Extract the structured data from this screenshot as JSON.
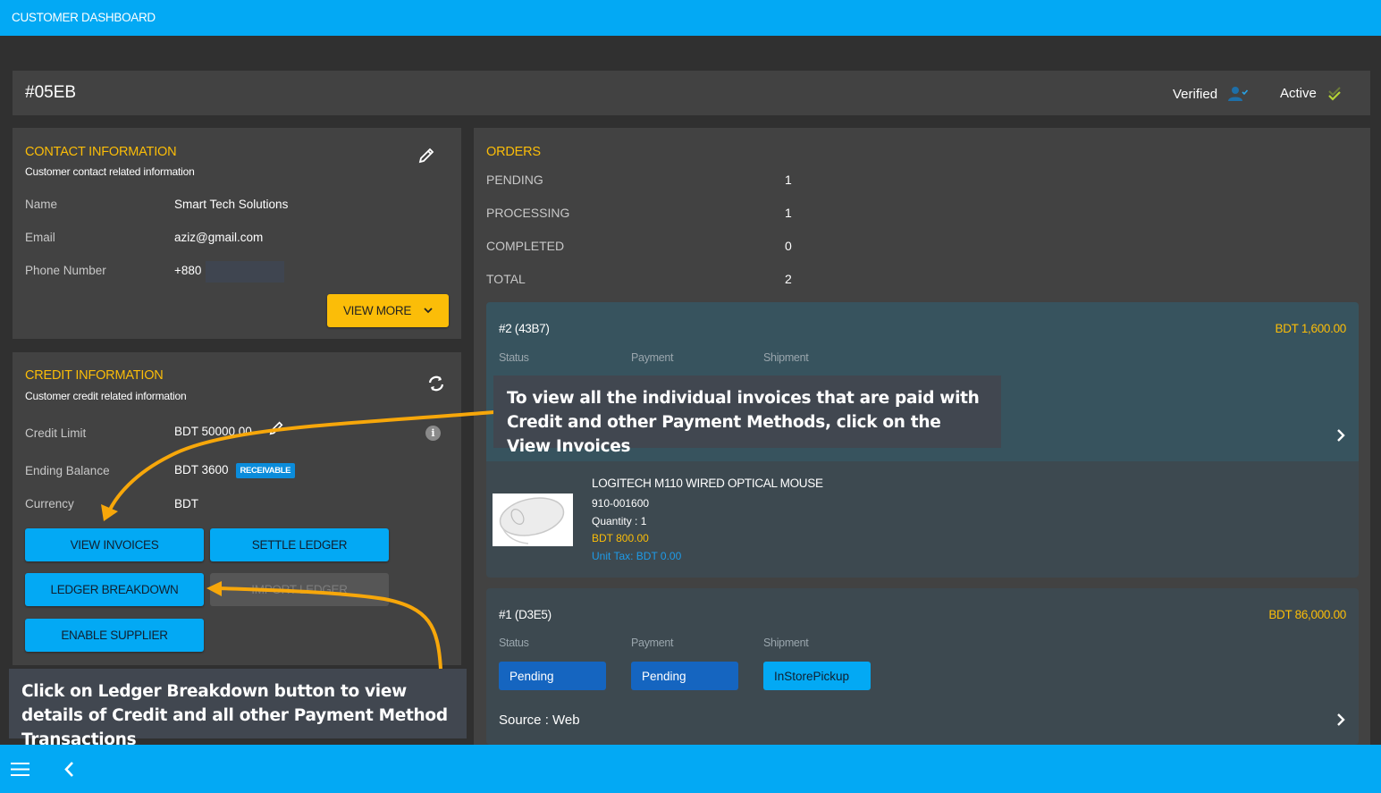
{
  "app": {
    "title": "CUSTOMER DASHBOARD"
  },
  "header": {
    "customer_id": "#05EB",
    "verified_label": "Verified",
    "active_label": "Active"
  },
  "contact": {
    "title": "CONTACT INFORMATION",
    "subtitle": "Customer contact related information",
    "rows": [
      {
        "label": "Name",
        "value": "Smart Tech Solutions"
      },
      {
        "label": "Email",
        "value": "aziz@gmail.com"
      },
      {
        "label": "Phone Number",
        "value": "+880"
      }
    ],
    "view_more_label": "VIEW MORE"
  },
  "credit": {
    "title": "CREDIT INFORMATION",
    "subtitle": "Customer credit related information",
    "rows": [
      {
        "label": "Credit Limit",
        "value": "BDT 50000.00"
      },
      {
        "label": "Ending Balance",
        "value": "BDT 3600",
        "badge": "RECEIVABLE"
      },
      {
        "label": "Currency",
        "value": "BDT"
      }
    ],
    "buttons": {
      "view_invoices": "VIEW INVOICES",
      "settle_ledger": "SETTLE LEDGER",
      "ledger_breakdown": "LEDGER BREAKDOWN",
      "import_ledger": "IMPORT LEDGER",
      "enable_supplier": "ENABLE SUPPLIER"
    }
  },
  "orders": {
    "title": "ORDERS",
    "summary": [
      {
        "label": "PENDING",
        "value": "1"
      },
      {
        "label": "PROCESSING",
        "value": "1"
      },
      {
        "label": "COMPLETED",
        "value": "0"
      },
      {
        "label": "TOTAL",
        "value": "2"
      }
    ],
    "list": [
      {
        "id": "#2 (43B7)",
        "total": "BDT 1,600.00",
        "status_label": "Status",
        "payment_label": "Payment",
        "shipment_label": "Shipment",
        "item": {
          "name": "LOGITECH M110 WIRED OPTICAL MOUSE",
          "sku": "910-001600",
          "quantity": "Quantity : 1",
          "price": "BDT 800.00",
          "unit_tax": "Unit Tax: BDT 0.00"
        }
      },
      {
        "id": "#1 (D3E5)",
        "total": "BDT 86,000.00",
        "status_label": "Status",
        "payment_label": "Payment",
        "shipment_label": "Shipment",
        "status": "Pending",
        "payment": "Pending",
        "shipment": "InStorePickup",
        "source": "Source : Web"
      }
    ]
  },
  "callouts": {
    "view_invoices": "To view all the individual invoices that are paid with Credit and other Payment Methods, click on the View Invoices",
    "ledger_breakdown": "Click on Ledger Breakdown button to view details of Credit and all other Payment Method Transactions"
  },
  "colors": {
    "primary": "#03a9f4",
    "accent": "#fbbd08",
    "panel": "#424242",
    "background": "#303030",
    "arrow": "#f7a70a"
  }
}
